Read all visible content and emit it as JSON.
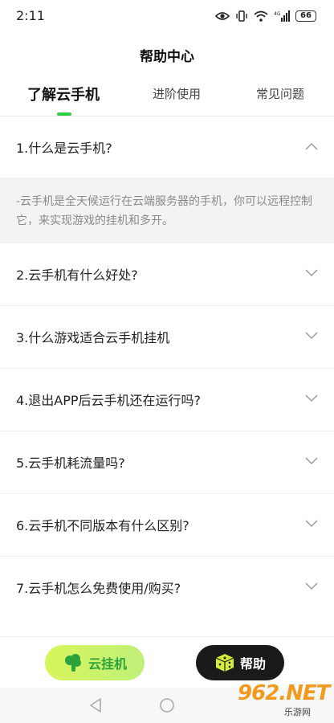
{
  "status_bar": {
    "time": "2:11",
    "battery": "66",
    "network": "4G"
  },
  "header": {
    "title": "帮助中心"
  },
  "tabs": [
    {
      "label": "了解云手机",
      "active": true
    },
    {
      "label": "进阶使用",
      "active": false
    },
    {
      "label": "常见问题",
      "active": false
    }
  ],
  "faq": [
    {
      "question": "1.什么是云手机?",
      "expanded": true,
      "answer": "-云手机是全天候运行在云端服务器的手机，你可以远程控制它，来实现游戏的挂机和多开。"
    },
    {
      "question": "2.云手机有什么好处?",
      "expanded": false
    },
    {
      "question": "3.什么游戏适合云手机挂机",
      "expanded": false
    },
    {
      "question": "4.退出APP后云手机还在运行吗?",
      "expanded": false
    },
    {
      "question": "5.云手机耗流量吗?",
      "expanded": false
    },
    {
      "question": "6.云手机不同版本有什么区别?",
      "expanded": false
    },
    {
      "question": "7.云手机怎么免费使用/购买?",
      "expanded": false
    }
  ],
  "bottom_bar": {
    "cloud_label": "云挂机",
    "help_label": "帮助"
  },
  "watermark": {
    "main": "962.NET",
    "sub": "乐游网"
  },
  "colors": {
    "accent": "#2fcf45",
    "cloud_button": "#d8f55b",
    "help_button": "#1a1a1a",
    "answer_bg": "#f2f3f5"
  },
  "icons": [
    "eye-icon",
    "vibrate-icon",
    "wifi-icon",
    "signal-icon",
    "battery-icon",
    "chevron-up-icon",
    "chevron-down-icon",
    "cloud-tree-icon",
    "dice-icon",
    "nav-back-icon",
    "nav-home-icon"
  ]
}
